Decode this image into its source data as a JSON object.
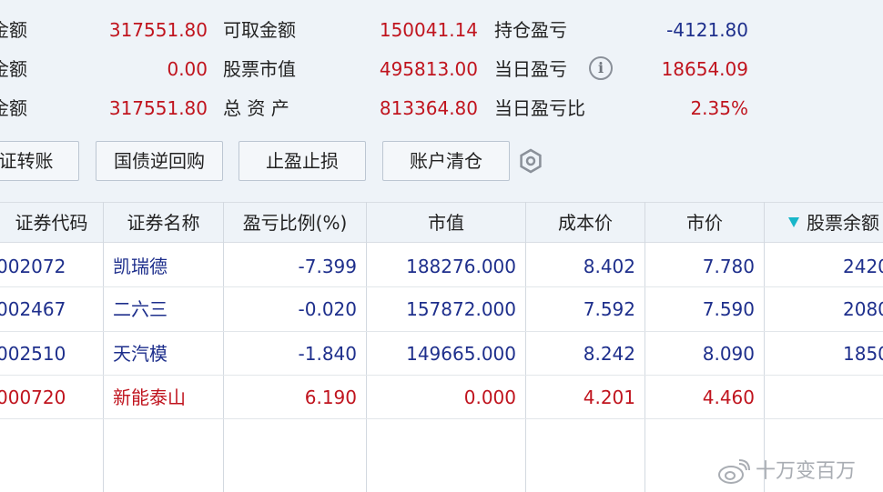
{
  "summary": {
    "col1": [
      {
        "label": "金额",
        "value": "317551.80"
      },
      {
        "label": "金额",
        "value": "0.00"
      },
      {
        "label": "金额",
        "value": "317551.80"
      }
    ],
    "col2": [
      {
        "label": "可取金额",
        "value": "150041.14"
      },
      {
        "label": "股票市值",
        "value": "495813.00"
      },
      {
        "label": "总 资 产",
        "value": "813364.80"
      }
    ],
    "col3": [
      {
        "label": "持仓盈亏",
        "value": "-4121.80"
      },
      {
        "label": "当日盈亏",
        "value": "18654.09"
      },
      {
        "label": "当日盈亏比",
        "value": "2.35%"
      }
    ]
  },
  "buttons": {
    "transfer": "证转账",
    "reverse_repo": "国债逆回购",
    "stop_profit_loss": "止盈止损",
    "clear_positions": "账户清仓"
  },
  "icons": {
    "info": "info-icon",
    "settings": "gear-icon",
    "sort": "sort-desc-icon",
    "watermark": "weibo-icon"
  },
  "table": {
    "headers": [
      "证券代码",
      "证券名称",
      "盈亏比例(%)",
      "市值",
      "成本价",
      "市价",
      "股票余额"
    ],
    "rows": [
      {
        "code": "002072",
        "name": "凯瑞德",
        "pnl_pct": "-7.399",
        "market_value": "188276.000",
        "cost": "8.402",
        "price": "7.780",
        "balance": "2420"
      },
      {
        "code": "002467",
        "name": "二六三",
        "pnl_pct": "-0.020",
        "market_value": "157872.000",
        "cost": "7.592",
        "price": "7.590",
        "balance": "2080"
      },
      {
        "code": "002510",
        "name": "天汽模",
        "pnl_pct": "-1.840",
        "market_value": "149665.000",
        "cost": "8.242",
        "price": "8.090",
        "balance": "1850"
      },
      {
        "code": "000720",
        "name": "新能泰山",
        "pnl_pct": "6.190",
        "market_value": "0.000",
        "cost": "4.201",
        "price": "4.460",
        "balance": ""
      }
    ]
  },
  "watermark": "十万变百万",
  "colors": {
    "positive": "#c0141e",
    "negative": "#1e2f8c",
    "panel_bg": "#eef3f8",
    "sort_icon": "#18b6c9"
  }
}
